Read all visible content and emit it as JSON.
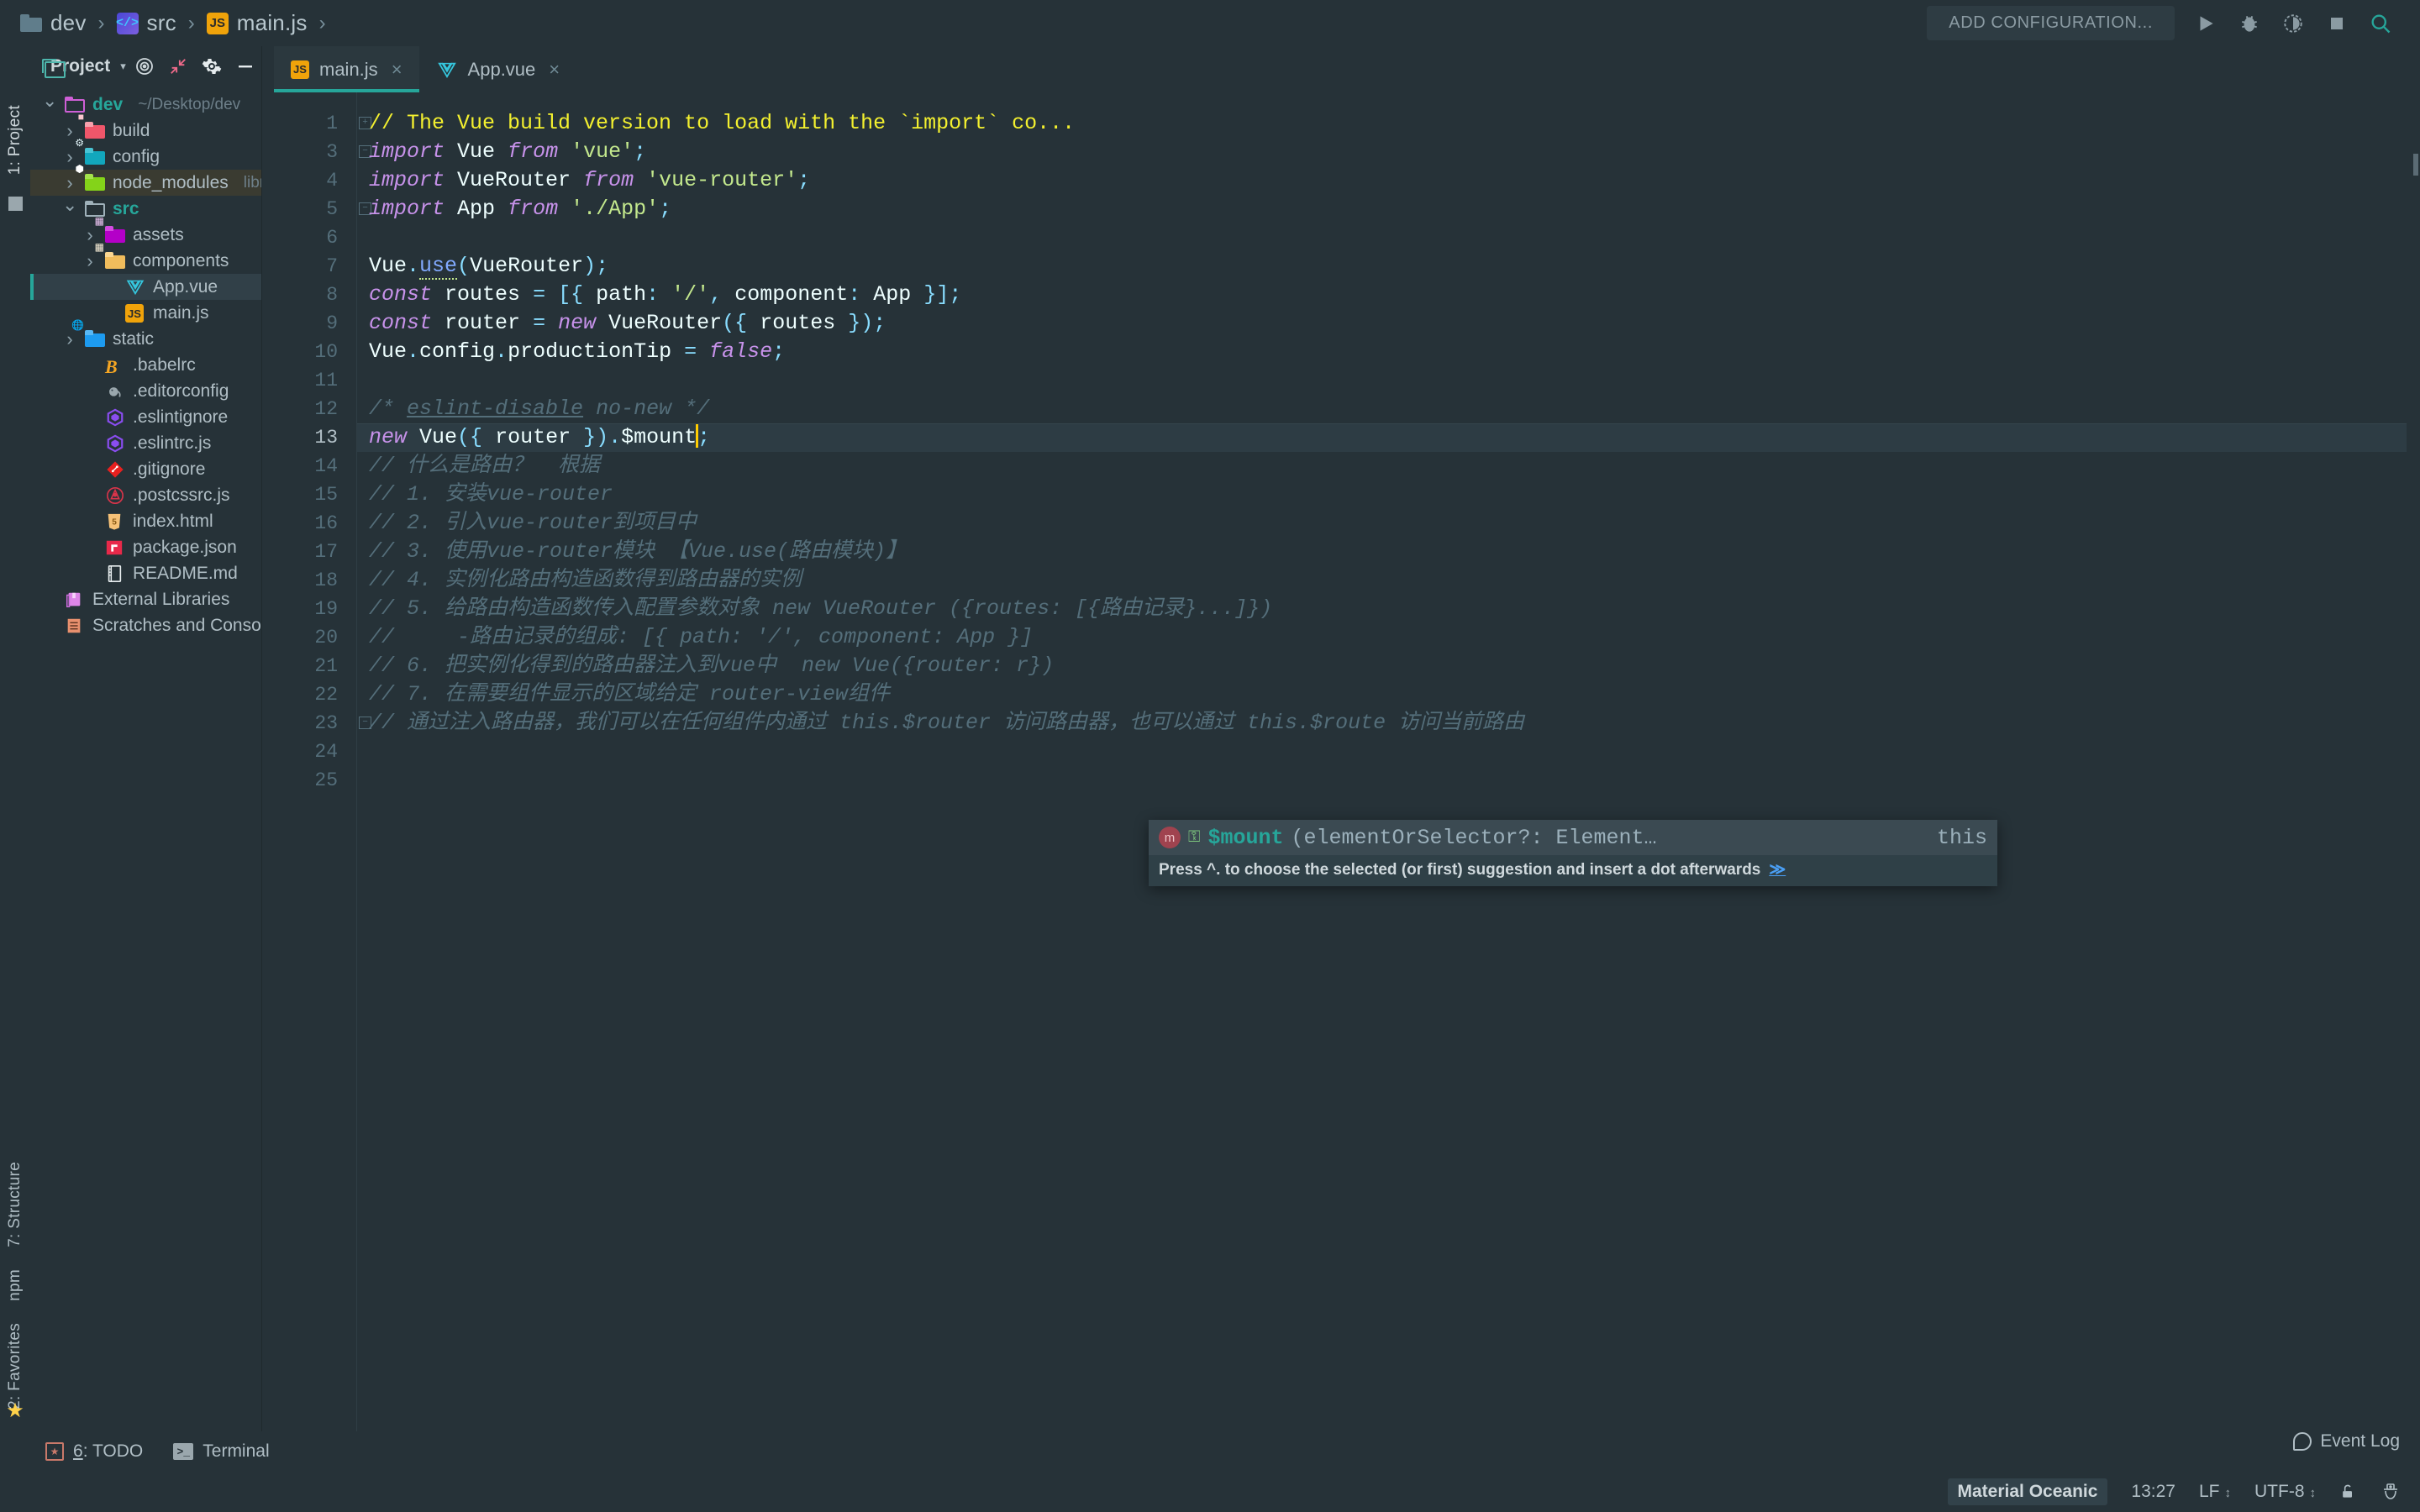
{
  "breadcrumb": {
    "items": [
      {
        "label": "dev",
        "icon": "folder-icon"
      },
      {
        "label": "src",
        "icon": "source-folder-icon"
      },
      {
        "label": "main.js",
        "icon": "js-file-icon"
      }
    ],
    "separator": "›"
  },
  "toolbar": {
    "add_configuration": "ADD CONFIGURATION...",
    "run_label": "Run",
    "debug_label": "Debug",
    "coverage_label": "Run with Coverage",
    "stop_label": "Stop",
    "search_label": "Search Everywhere"
  },
  "left_strip": {
    "project_tab": "1: Project",
    "structure_tab": "7: Structure",
    "npm_tab": "npm",
    "favorites_tab": "2: Favorites"
  },
  "project_panel": {
    "title": "Project",
    "caret": "▾",
    "actions": [
      "locate-icon",
      "collapse-all-icon",
      "settings-icon",
      "hide-icon"
    ],
    "tree": [
      {
        "label": "dev",
        "sub": "~/Desktop/dev",
        "indent": 0,
        "arrow": "open",
        "icon": "folder-purple",
        "bold": true,
        "state": "none"
      },
      {
        "label": "build",
        "sub": "",
        "indent": 1,
        "arrow": "closed",
        "icon": "folder-red",
        "bold": false,
        "state": "none"
      },
      {
        "label": "config",
        "sub": "",
        "indent": 1,
        "arrow": "closed",
        "icon": "folder-teal-gear",
        "bold": false,
        "state": "none"
      },
      {
        "label": "node_modules",
        "sub": "library root",
        "indent": 1,
        "arrow": "closed",
        "icon": "folder-green-node",
        "bold": false,
        "state": "node"
      },
      {
        "label": "src",
        "sub": "",
        "indent": 1,
        "arrow": "open",
        "icon": "folder-outline",
        "bold": true,
        "state": "none"
      },
      {
        "label": "assets",
        "sub": "",
        "indent": 2,
        "arrow": "closed",
        "icon": "folder-magenta",
        "bold": false,
        "state": "none"
      },
      {
        "label": "components",
        "sub": "",
        "indent": 2,
        "arrow": "closed",
        "icon": "folder-amber",
        "bold": false,
        "state": "none"
      },
      {
        "label": "App.vue",
        "sub": "",
        "indent": 3,
        "arrow": "none",
        "icon": "vue-file",
        "bold": false,
        "state": "file"
      },
      {
        "label": "main.js",
        "sub": "",
        "indent": 3,
        "arrow": "none",
        "icon": "js-file",
        "bold": false,
        "state": "none"
      },
      {
        "label": "static",
        "sub": "",
        "indent": 1,
        "arrow": "closed",
        "icon": "folder-blue-globe",
        "bold": false,
        "state": "none"
      },
      {
        "label": ".babelrc",
        "sub": "",
        "indent": 2,
        "arrow": "none",
        "icon": "babel-file",
        "bold": false,
        "state": "none"
      },
      {
        "label": ".editorconfig",
        "sub": "",
        "indent": 2,
        "arrow": "none",
        "icon": "editorconfig-file",
        "bold": false,
        "state": "none"
      },
      {
        "label": ".eslintignore",
        "sub": "",
        "indent": 2,
        "arrow": "none",
        "icon": "eslint-file",
        "bold": false,
        "state": "none"
      },
      {
        "label": ".eslintrc.js",
        "sub": "",
        "indent": 2,
        "arrow": "none",
        "icon": "eslint-file",
        "bold": false,
        "state": "none"
      },
      {
        "label": ".gitignore",
        "sub": "",
        "indent": 2,
        "arrow": "none",
        "icon": "git-file",
        "bold": false,
        "state": "none"
      },
      {
        "label": ".postcssrc.js",
        "sub": "",
        "indent": 2,
        "arrow": "none",
        "icon": "postcss-file",
        "bold": false,
        "state": "none"
      },
      {
        "label": "index.html",
        "sub": "",
        "indent": 2,
        "arrow": "none",
        "icon": "html-file",
        "bold": false,
        "state": "none"
      },
      {
        "label": "package.json",
        "sub": "",
        "indent": 2,
        "arrow": "none",
        "icon": "npm-file",
        "bold": false,
        "state": "none"
      },
      {
        "label": "README.md",
        "sub": "",
        "indent": 2,
        "arrow": "none",
        "icon": "markdown-file",
        "bold": false,
        "state": "none"
      },
      {
        "label": "External Libraries",
        "sub": "",
        "indent": 0,
        "arrow": "none",
        "icon": "libraries",
        "bold": false,
        "state": "none"
      },
      {
        "label": "Scratches and Consoles",
        "sub": "",
        "indent": 0,
        "arrow": "none",
        "icon": "scratches",
        "bold": false,
        "state": "none"
      }
    ]
  },
  "tabs": [
    {
      "label": "main.js",
      "icon": "js-file-icon",
      "active": true,
      "close": "×"
    },
    {
      "label": "App.vue",
      "icon": "vue-file-icon",
      "active": false,
      "close": "×"
    }
  ],
  "editor": {
    "line_numbers": [
      "1",
      "3",
      "4",
      "5",
      "6",
      "7",
      "8",
      "9",
      "10",
      "11",
      "12",
      "13",
      "14",
      "15",
      "16",
      "17",
      "18",
      "19",
      "20",
      "21",
      "22",
      "23",
      "24",
      "25"
    ],
    "current_line": "13",
    "lines": [
      "// The Vue build version to load with the `import` co...",
      "import Vue from 'vue';",
      "import VueRouter from 'vue-router';",
      "import App from './App';",
      "",
      "Vue.use(VueRouter);",
      "const routes = [{ path: '/', component: App }];",
      "const router = new VueRouter({ routes });",
      "Vue.config.productionTip = false;",
      "",
      "/* eslint-disable no-new */",
      "new Vue({ router }).$mount;",
      "// 什么是路由？  根据",
      "// 1. 安装vue-router",
      "// 2. 引入vue-router到项目中",
      "// 3. 使用vue-router模块 【Vue.use(路由模块)】",
      "// 4. 实例化路由构造函数得到路由器的实例",
      "// 5. 给路由构造函数传入配置参数对象 new VueRouter ({routes: [{路由记录}...]})",
      "//     -路由记录的组成: [{ path: '/', component: App }]",
      "// 6. 把实例化得到的路由器注入到vue中  new Vue({router: r})",
      "// 7. 在需要组件显示的区域给定 router-view组件",
      "// 通过注入路由器，我们可以在任何组件内通过 this.$router 访问路由器，也可以通过 this.$route 访问当前路由",
      "",
      ""
    ]
  },
  "autocomplete": {
    "icon_method": "m",
    "icon_private": "⚿",
    "name": "$mount",
    "signature": "(elementOrSelector?: Element…",
    "type": "this",
    "hint": "Press ^. to choose the selected (or first) suggestion and insert a dot afterwards",
    "hint_link": "≫"
  },
  "bottom_bar": {
    "todo_num": "6",
    "todo_label": ": TODO",
    "terminal_label": "Terminal",
    "event_log": "Event Log"
  },
  "status_bar": {
    "theme": "Material Oceanic",
    "position": "13:27",
    "line_separator": "LF",
    "encoding": "UTF-8",
    "updown": "↕",
    "lock_icon": "unlocked-icon",
    "hat_icon": "inspector-hat-icon"
  },
  "colors": {
    "background": "#263238",
    "accent": "#26a69a",
    "selection": "#314048",
    "comment": "#546e7a",
    "keyword": "#c792ea",
    "string": "#c3e88d",
    "punctuation": "#89ddff"
  }
}
